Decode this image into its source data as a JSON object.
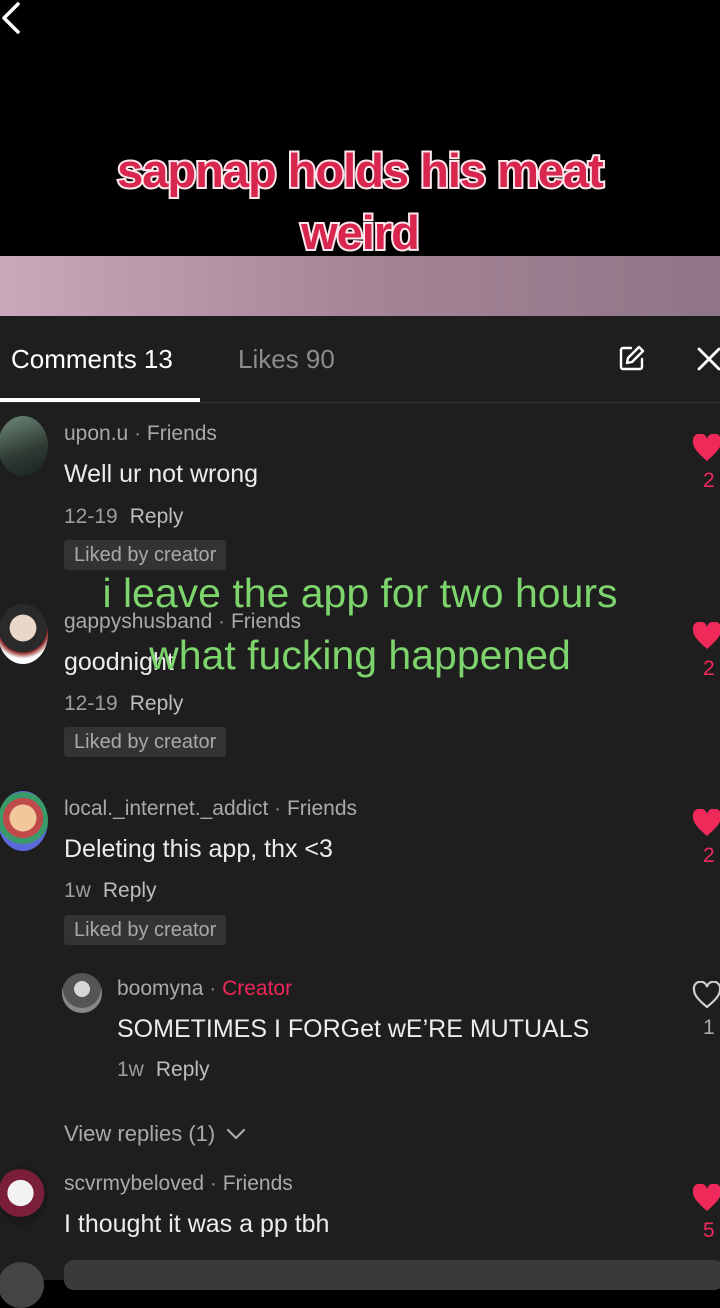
{
  "video": {
    "caption": "sapnap holds his meat weird",
    "overlay_text": "i leave the app for two hours what fucking happened"
  },
  "tabs": {
    "comments_label": "Comments 13",
    "likes_label": "Likes 90"
  },
  "comments": [
    {
      "username": "upon.u",
      "relation": "Friends",
      "text": "Well ur not wrong",
      "time": "12-19",
      "reply_label": "Reply",
      "badge": "Liked by creator",
      "like_count": "2"
    },
    {
      "username": "gappyshusband",
      "relation": "Friends",
      "text": "goodnight",
      "time": "12-19",
      "reply_label": "Reply",
      "badge": "Liked by creator",
      "like_count": "2"
    },
    {
      "username": "local._internet._addict",
      "relation": "Friends",
      "text": "Deleting this app, thx <3",
      "time": "1w",
      "reply_label": "Reply",
      "badge": "Liked by creator",
      "like_count": "2",
      "reply": {
        "username": "boomyna",
        "relation": "Creator",
        "text": "SOMETIMES I FORGet wE’RE MUTUALS",
        "time": "1w",
        "reply_label": "Reply",
        "like_count": "1"
      },
      "view_replies": "View replies (1)"
    },
    {
      "username": "scvrmybeloved",
      "relation": "Friends",
      "text": "I thought it was a pp tbh",
      "like_count": "5"
    }
  ],
  "colors": {
    "accent": "#ef2a5b",
    "panel_bg": "#1e1e1e",
    "overlay_green": "#7dd46c"
  }
}
